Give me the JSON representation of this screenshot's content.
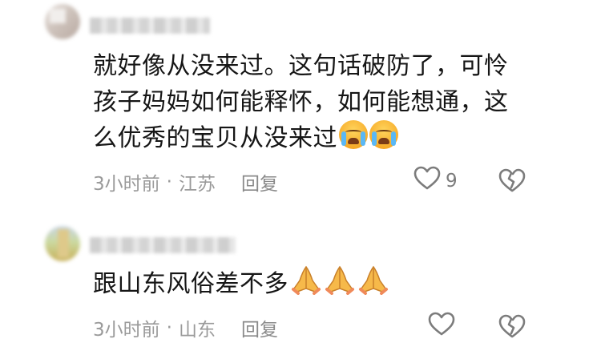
{
  "comments": [
    {
      "body_text": "就好像从没来过。这句话破防了，可怜孩子妈妈如何能释怀，如何能想通，这么优秀的宝贝从没来过",
      "line1": "就好像从没来过。这句话破防了，可怜",
      "line2": "孩子妈妈如何能释怀，如何能想通，这",
      "line3": "么优秀的宝贝从没来过",
      "emojis": [
        "crying-face-emoji",
        "crying-face-emoji"
      ],
      "time": "3小时前",
      "separator": "·",
      "location": "江苏",
      "reply_label": "回复",
      "like_count": "9",
      "like_icon": "heart-icon",
      "dislike_icon": "broken-heart-icon"
    },
    {
      "body_text": "跟山东风俗差不多",
      "emojis": [
        "folded-hands-emoji",
        "folded-hands-emoji",
        "folded-hands-emoji"
      ],
      "time": "3小时前",
      "separator": "·",
      "location": "山东",
      "reply_label": "回复",
      "like_icon": "heart-icon",
      "dislike_icon": "broken-heart-icon"
    }
  ],
  "colors": {
    "text": "#161616",
    "meta": "#9a9a9a",
    "icon": "#7c7c7c",
    "background": "#ffffff"
  }
}
